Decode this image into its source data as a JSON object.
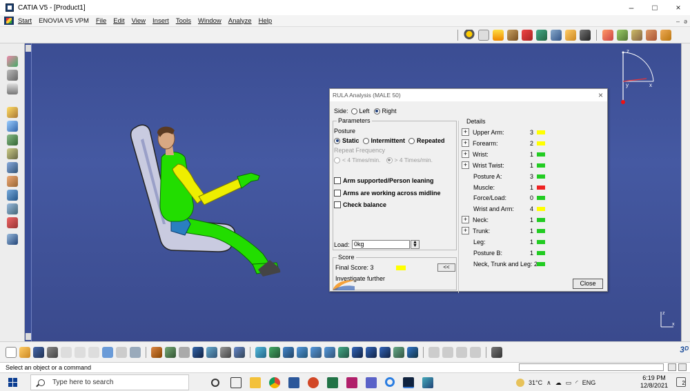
{
  "window": {
    "title": "CATIA V5 - [Product1]",
    "controls": [
      "–",
      "□",
      "×"
    ]
  },
  "menu": {
    "items": [
      "Start",
      "ENOVIA V5 VPM",
      "File",
      "Edit",
      "View",
      "Insert",
      "Tools",
      "Window",
      "Analyze",
      "Help"
    ],
    "mdi": [
      "–",
      "ǝ"
    ]
  },
  "compass": {
    "axis_z": "z",
    "axis_x": "x",
    "axis_y": "y"
  },
  "corner_axis": {
    "z": "z",
    "x": "x"
  },
  "dialog": {
    "title": "RULA Analysis (MALE 50)",
    "close_x": "×",
    "side": {
      "label": "Side:",
      "left": "Left",
      "right": "Right",
      "selected": "Right"
    },
    "parameters": {
      "group": "Parameters",
      "posture_label": "Posture",
      "posture_options": [
        "Static",
        "Intermittent",
        "Repeated"
      ],
      "posture_selected": "Static",
      "repeat_label": "Repeat Frequency",
      "repeat_options": [
        "< 4 Times/min.",
        "> 4 Times/min."
      ],
      "repeat_selected": "> 4 Times/min.",
      "checks": [
        "Arm supported/Person leaning",
        "Arms are working across midline",
        "Check balance"
      ],
      "load_label": "Load:",
      "load_value": "0kg"
    },
    "score": {
      "group": "Score",
      "final_label": "Final Score: 3",
      "final_color": "#ffff00",
      "message": "Investigate further",
      "toggle": "<<"
    },
    "details": {
      "group": "Details",
      "rows": [
        {
          "label": "Upper Arm:",
          "value": "3",
          "color": "#ffff00",
          "expand": true
        },
        {
          "label": "Forearm:",
          "value": "2",
          "color": "#ffff00",
          "expand": true
        },
        {
          "label": "Wrist:",
          "value": "1",
          "color": "#22cc22",
          "expand": true
        },
        {
          "label": "Wrist Twist:",
          "value": "1",
          "color": "#22cc22",
          "expand": true
        },
        {
          "label": "Posture A:",
          "value": "3",
          "color": "#22cc22",
          "expand": false
        },
        {
          "label": "Muscle:",
          "value": "1",
          "color": "#ee2222",
          "expand": false
        },
        {
          "label": "Force/Load:",
          "value": "0",
          "color": "#22cc22",
          "expand": false
        },
        {
          "label": "Wrist and Arm:",
          "value": "4",
          "color": "#ffff00",
          "expand": false
        },
        {
          "label": "Neck:",
          "value": "1",
          "color": "#22cc22",
          "expand": true
        },
        {
          "label": "Trunk:",
          "value": "1",
          "color": "#22cc22",
          "expand": true
        },
        {
          "label": "Leg:",
          "value": "1",
          "color": "#22cc22",
          "expand": false
        },
        {
          "label": "Posture B:",
          "value": "1",
          "color": "#22cc22",
          "expand": false
        },
        {
          "label": "Neck, Trunk and Leg: 2",
          "value": "",
          "color": "#22cc22",
          "expand": false
        }
      ]
    },
    "close_button": "Close"
  },
  "status": {
    "message": "Select an object or a command"
  },
  "taskbar": {
    "search_placeholder": "Type here to search",
    "weather": "31°C",
    "lang": "ENG",
    "time": "6:19 PM",
    "date": "12/8/2021",
    "notifications": "2"
  },
  "colors": {
    "viewport": "#3f52a0",
    "manikin_green": "#22dd00",
    "manikin_yellow": "#eeee00"
  }
}
